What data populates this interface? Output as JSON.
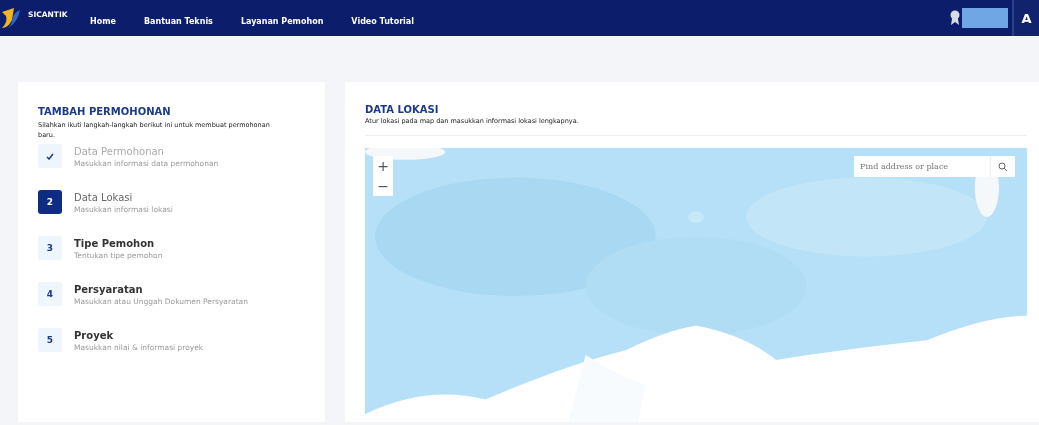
{
  "navbar": {
    "brand": "SICANTIK",
    "links": [
      "Home",
      "Bantuan Teknis",
      "Layanan Pemohon",
      "Video Tutorial"
    ],
    "user_initial": "A"
  },
  "steps_panel": {
    "title": "TAMBAH PERMOHONAN",
    "description": "Silahkan ikuti langkah-langkah berikut ini untuk membuat permohonan baru.",
    "steps": [
      {
        "completed": true,
        "selected": false,
        "title": "Data Permohonan",
        "subtitle": "Masukkan informasi data permohonan"
      },
      {
        "completed": false,
        "selected": true,
        "number": "2",
        "title": "Data Lokasi",
        "subtitle": "Masukkan informasi lokasi"
      },
      {
        "completed": false,
        "selected": false,
        "number": "3",
        "title": "Tipe Pemohon",
        "subtitle": "Tentukan tipe pemohon"
      },
      {
        "completed": false,
        "selected": false,
        "number": "4",
        "title": "Persyaratan",
        "subtitle": "Masukkan atau Unggah Dokumen Persyaratan"
      },
      {
        "completed": false,
        "selected": false,
        "number": "5",
        "title": "Proyek",
        "subtitle": "Masukkan nilai & informasi proyek"
      }
    ]
  },
  "location_panel": {
    "title": "DATA LOKASI",
    "description": "Atur lokasi pada map dan masukkan informasi lokasi lengkapnya.",
    "map": {
      "kind": "picture",
      "zoom_in": "+",
      "zoom_out": "−",
      "search_placeholder": "Find address or place"
    }
  }
}
